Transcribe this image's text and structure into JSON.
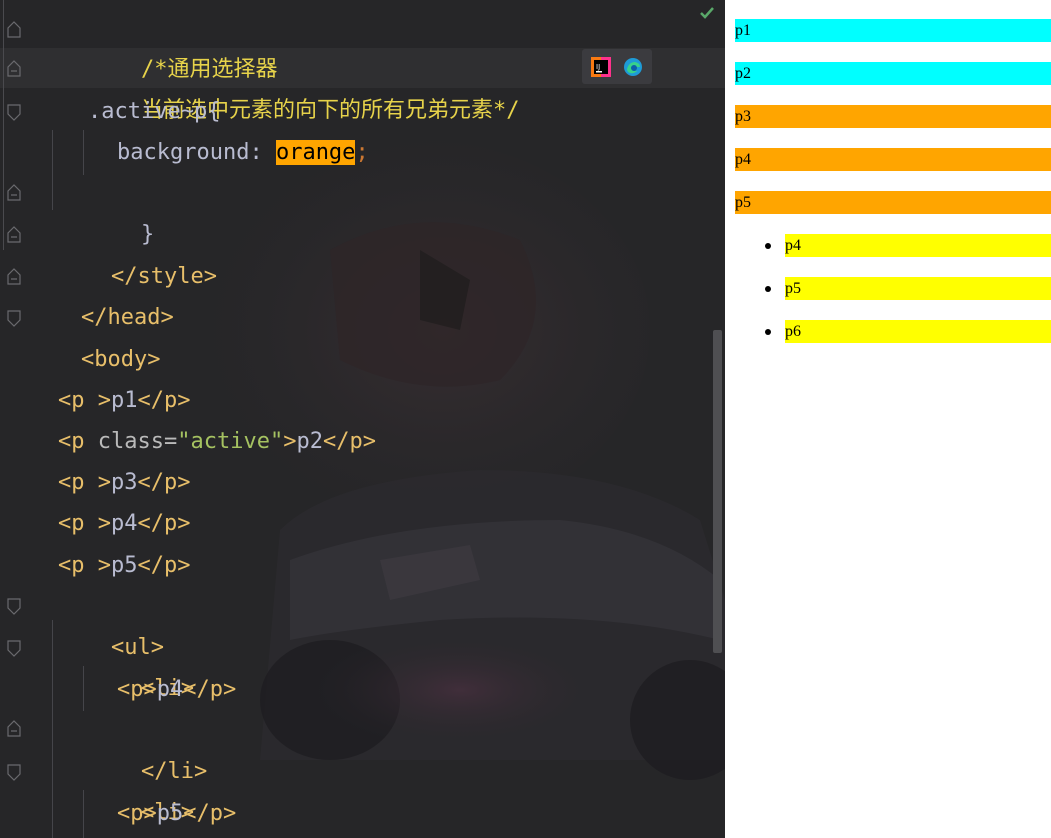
{
  "editor": {
    "lines": {
      "l1": "/*通用选择器",
      "l2": "当前选中元素的向下的所有兄弟元素*/",
      "l3_sel": ".active~p",
      "l3_brace": "{",
      "l4_prop": "background",
      "l4_colon": ": ",
      "l4_val": "orange",
      "l4_semi": ";",
      "l5": "}",
      "l6": "</style>",
      "l7": "</head>",
      "l8": "<body>",
      "l10_open": "<p ",
      "l10_gt": ">",
      "l10_text": "p1",
      "l10_close": "</p>",
      "l11_open": "<p ",
      "l11_attr": "class=",
      "l11_str": "\"active\"",
      "l11_gt": ">",
      "l11_text": "p2",
      "l11_close": "</p>",
      "l12_open": "<p ",
      "l12_gt": ">",
      "l12_text": "p3",
      "l12_close": "</p>",
      "l13_open": "<p ",
      "l13_gt": ">",
      "l13_text": "p4",
      "l13_close": "</p>",
      "l14_open": "<p ",
      "l14_gt": ">",
      "l14_text": "p5",
      "l14_close": "</p>",
      "l15": "<ul>",
      "l16": "<li>",
      "l17_open": "<p>",
      "l17_text": "p4",
      "l17_close": "</p>",
      "l18": "</li>",
      "l19": "<li>",
      "l20_open": "<p>",
      "l20_text": "p5",
      "l20_close": "</p>"
    },
    "icons": {
      "ide": "jetbrains-browser-icon",
      "edge": "edge-browser-icon",
      "status": "check-icon"
    },
    "colors": {
      "tag": "#e8bf6a",
      "string": "#a5c261",
      "comment": "#e7d34a",
      "highlight": "#ffa500"
    }
  },
  "preview": {
    "paragraphs": [
      {
        "label": "p1",
        "color": "#00ffff"
      },
      {
        "label": "p2",
        "color": "#00ffff"
      },
      {
        "label": "p3",
        "color": "#ffa500"
      },
      {
        "label": "p4",
        "color": "#ffa500"
      },
      {
        "label": "p5",
        "color": "#ffa500"
      }
    ],
    "list_items": [
      {
        "label": "p4",
        "color": "#ffff00"
      },
      {
        "label": "p5",
        "color": "#ffff00"
      },
      {
        "label": "p6",
        "color": "#ffff00"
      }
    ]
  }
}
